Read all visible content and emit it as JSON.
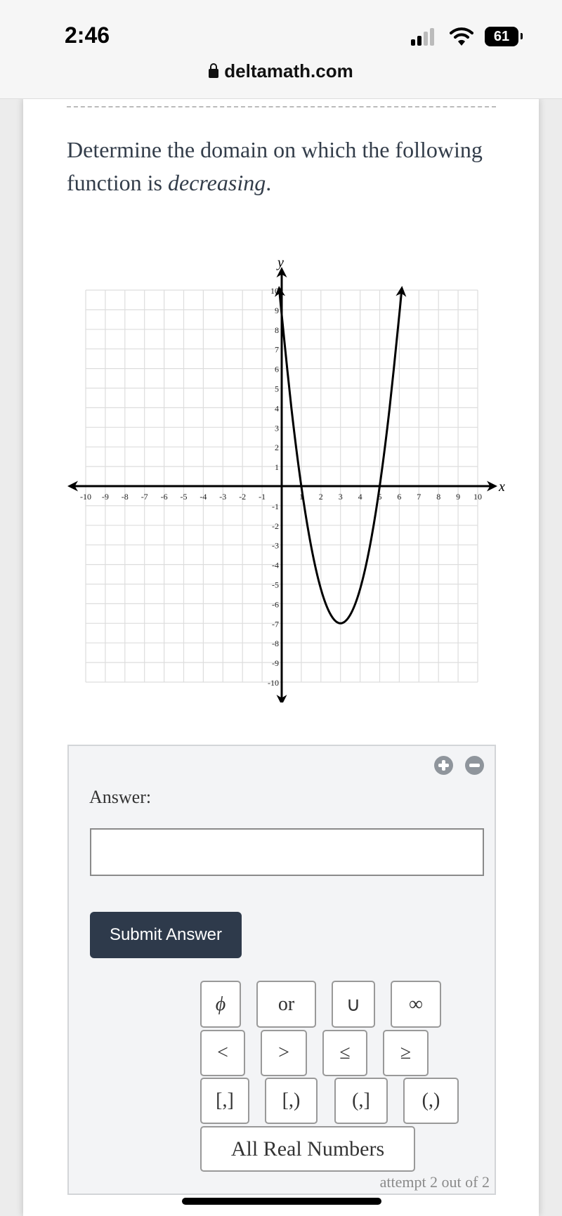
{
  "status_bar": {
    "time": "2:46",
    "battery": "61",
    "url": "deltamath.com"
  },
  "question": {
    "prefix": "Determine the domain on which the following function is ",
    "emphasis": "decreasing",
    "suffix": "."
  },
  "chart_data": {
    "type": "line",
    "xlabel": "x",
    "ylabel": "y",
    "xlim": [
      -10,
      10
    ],
    "ylim": [
      -10,
      10
    ],
    "grid": true,
    "x_ticks": [
      "-10",
      "-9",
      "-8",
      "-7",
      "-6",
      "-5",
      "-4",
      "-3",
      "-2",
      "-1",
      "1",
      "2",
      "3",
      "4",
      "5",
      "6",
      "7",
      "8",
      "9",
      "10"
    ],
    "y_ticks": [
      "10",
      "9",
      "8",
      "7",
      "6",
      "5",
      "4",
      "3",
      "2",
      "1",
      "-1",
      "-2",
      "-3",
      "-4",
      "-5",
      "-6",
      "-7",
      "-8",
      "-9",
      "-10"
    ],
    "series": [
      {
        "x": [
          -0.12,
          0,
          0.5,
          1,
          1.5,
          2,
          2.5,
          3,
          3.5,
          4,
          4.5,
          5,
          5.5,
          6,
          6.12
        ],
        "y": [
          10,
          8.75,
          3.94,
          0,
          -3.06,
          -5.25,
          -6.56,
          -7,
          -6.56,
          -5.25,
          -3.06,
          0,
          3.94,
          8.75,
          10
        ]
      }
    ],
    "arrows_on_ends": true,
    "line_color": "#000000",
    "grid_color": "#dddddd"
  },
  "answer": {
    "zoom_in_icon": "plus-circle-icon",
    "zoom_out_icon": "minus-circle-icon",
    "label": "Answer:",
    "input_value": "",
    "submit_label": "Submit Answer",
    "keys": [
      "ϕ",
      "or",
      "∪",
      "∞",
      "<",
      ">",
      "≤",
      "≥",
      "[,]",
      "[,)",
      "(,]",
      "(,)",
      "All Real Numbers"
    ],
    "attempt": "attempt 2 out of 2"
  },
  "colors": {
    "submit_bg": "#2e3a4b",
    "text": "#333d4a",
    "panel_bg": "#f3f4f6"
  }
}
